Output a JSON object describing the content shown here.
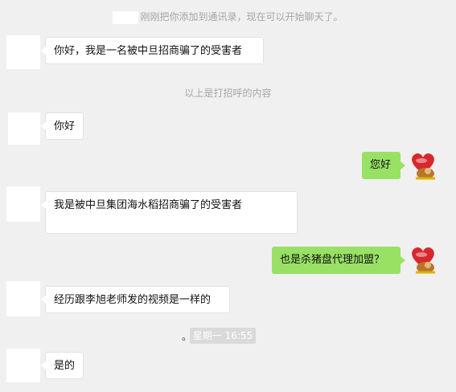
{
  "system": {
    "added_notice": "刚刚把你添加到通讯录，现在可以开始聊天了。",
    "greeting_separator": "以上是打招呼的内容",
    "timestamp": "星期一 16:55",
    "dot": "。"
  },
  "messages": [
    {
      "side": "in",
      "text": "你好，我是一名被中旦招商骗了的受害者"
    },
    {
      "side": "in",
      "text": "你好"
    },
    {
      "side": "out",
      "text": "您好"
    },
    {
      "side": "in",
      "text": "我是被中旦集团海水稻招商骗了的受害者"
    },
    {
      "side": "out",
      "text": "也是杀猪盘代理加盟？"
    },
    {
      "side": "in",
      "text": "经历跟李旭老师发的视频是一样的"
    },
    {
      "side": "in",
      "text": "是的"
    }
  ],
  "colors": {
    "background": "#f0f0f0",
    "outgoing_bubble": "#98e165",
    "incoming_bubble": "#ffffff"
  },
  "icons": {
    "self_avatar": "heart-cartoon-avatar-icon"
  }
}
